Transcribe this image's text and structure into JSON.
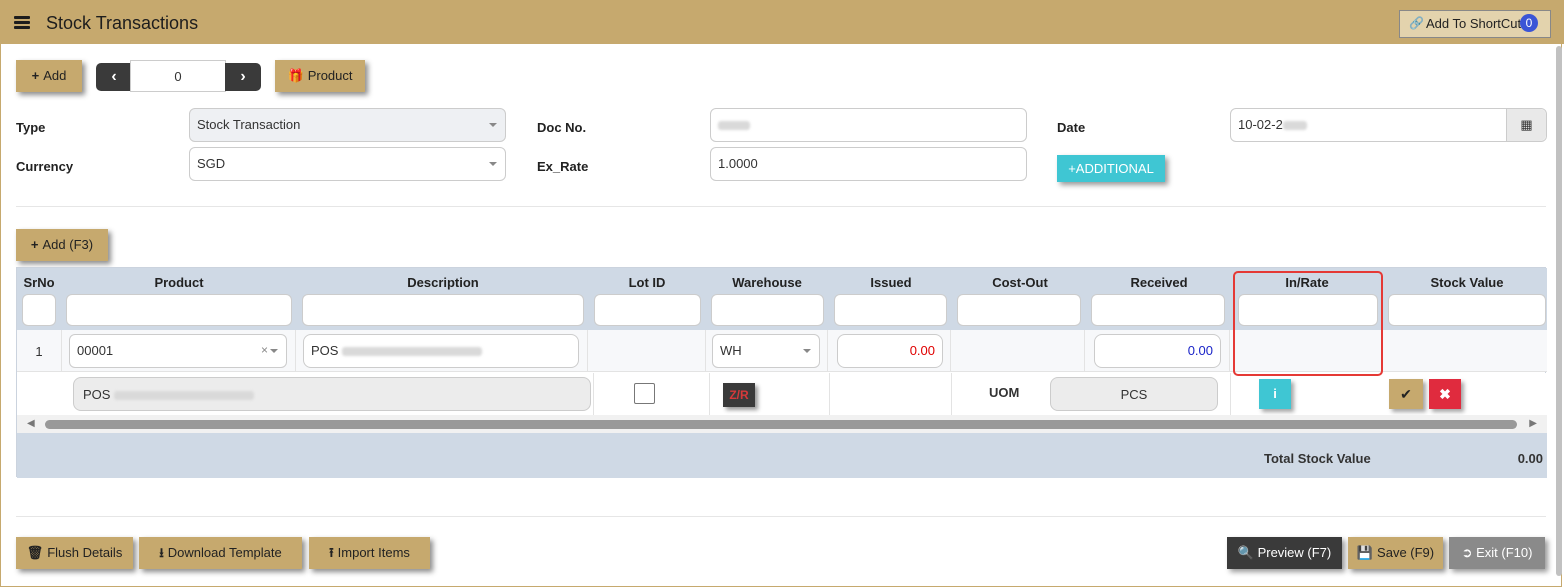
{
  "window": {
    "title": "Stock Transactions"
  },
  "header": {
    "shortcut_label": "Add To ShortCut",
    "shortcut_count": "0"
  },
  "toolbar": {
    "add_label": "Add",
    "record_number": "0",
    "product_label": "Product"
  },
  "form": {
    "type_label": "Type",
    "type_value": "Stock Transaction",
    "docno_label": "Doc No.",
    "date_label": "Date",
    "date_value": "10-02-2",
    "currency_label": "Currency",
    "currency_value": "SGD",
    "exrate_label": "Ex_Rate",
    "exrate_value": "1.0000",
    "additional_label": "ADDITIONAL"
  },
  "grid": {
    "add_row_label": "Add (F3)",
    "columns": [
      "SrNo",
      "Product",
      "Description",
      "Lot ID",
      "Warehouse",
      "Issued",
      "Cost-Out",
      "Received",
      "In/Rate",
      "Stock Value"
    ],
    "row": {
      "srno": "1",
      "product": "00001",
      "description": "POS",
      "warehouse": "WH",
      "issued": "0.00",
      "received": "0.00",
      "detail_description": "POS",
      "zr_label": "Z/R",
      "uom_label": "UOM",
      "uom_value": "PCS"
    },
    "footer": {
      "total_label": "Total Stock Value",
      "total_value": "0.00"
    }
  },
  "footer_buttons": {
    "flush": "Flush Details",
    "download": "Download Template",
    "import": "Import Items",
    "preview": "Preview (F7)",
    "save": "Save (F9)",
    "exit": "Exit (F10)"
  },
  "colors": {
    "accent": "#c6a96e",
    "header_row": "#cfd9e5",
    "info": "#3fc6d3",
    "danger": "#e53935"
  }
}
